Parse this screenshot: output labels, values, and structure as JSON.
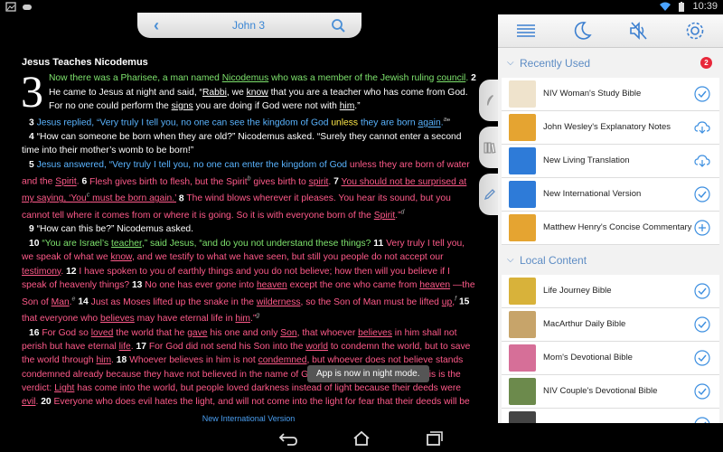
{
  "status": {
    "time": "10:39"
  },
  "nav": {
    "reference": "John 3"
  },
  "bible": {
    "heading": "Jesus Teaches Nicodemus",
    "dropcap": "3",
    "footer_version": "New International Version"
  },
  "toast": "App is now in night mode.",
  "panel": {
    "recently_used_label": "Recently Used",
    "recently_used_count": "2",
    "local_content_label": "Local Content",
    "recent": [
      {
        "title": "NIV Woman's Study Bible",
        "action": "check",
        "color": "#efe3cc"
      },
      {
        "title": "John Wesley's Explanatory Notes",
        "action": "download",
        "color": "#e5a431"
      },
      {
        "title": "New Living Translation",
        "action": "download",
        "color": "#2e7bd8"
      },
      {
        "title": "New International Version",
        "action": "check",
        "color": "#2e7bd8"
      },
      {
        "title": "Matthew Henry's Concise Commentary",
        "action": "add",
        "color": "#e5a431"
      }
    ],
    "local": [
      {
        "title": "Life Journey Bible",
        "action": "check",
        "color": "#d8b23a"
      },
      {
        "title": "MacArthur Daily Bible",
        "action": "check",
        "color": "#c7a46a"
      },
      {
        "title": "Mom's Devotional Bible",
        "action": "check",
        "color": "#d66f98"
      },
      {
        "title": "NIV Couple's Devotional Bible",
        "action": "check",
        "color": "#6c8a4c"
      },
      {
        "title": "",
        "action": "check",
        "color": "#444"
      }
    ]
  },
  "colors": {
    "accent": "#3a86d4",
    "words_of_jesus": "#7ee36d",
    "text_pink": "#ff5a8a",
    "text_blue": "#5ab4ff"
  }
}
